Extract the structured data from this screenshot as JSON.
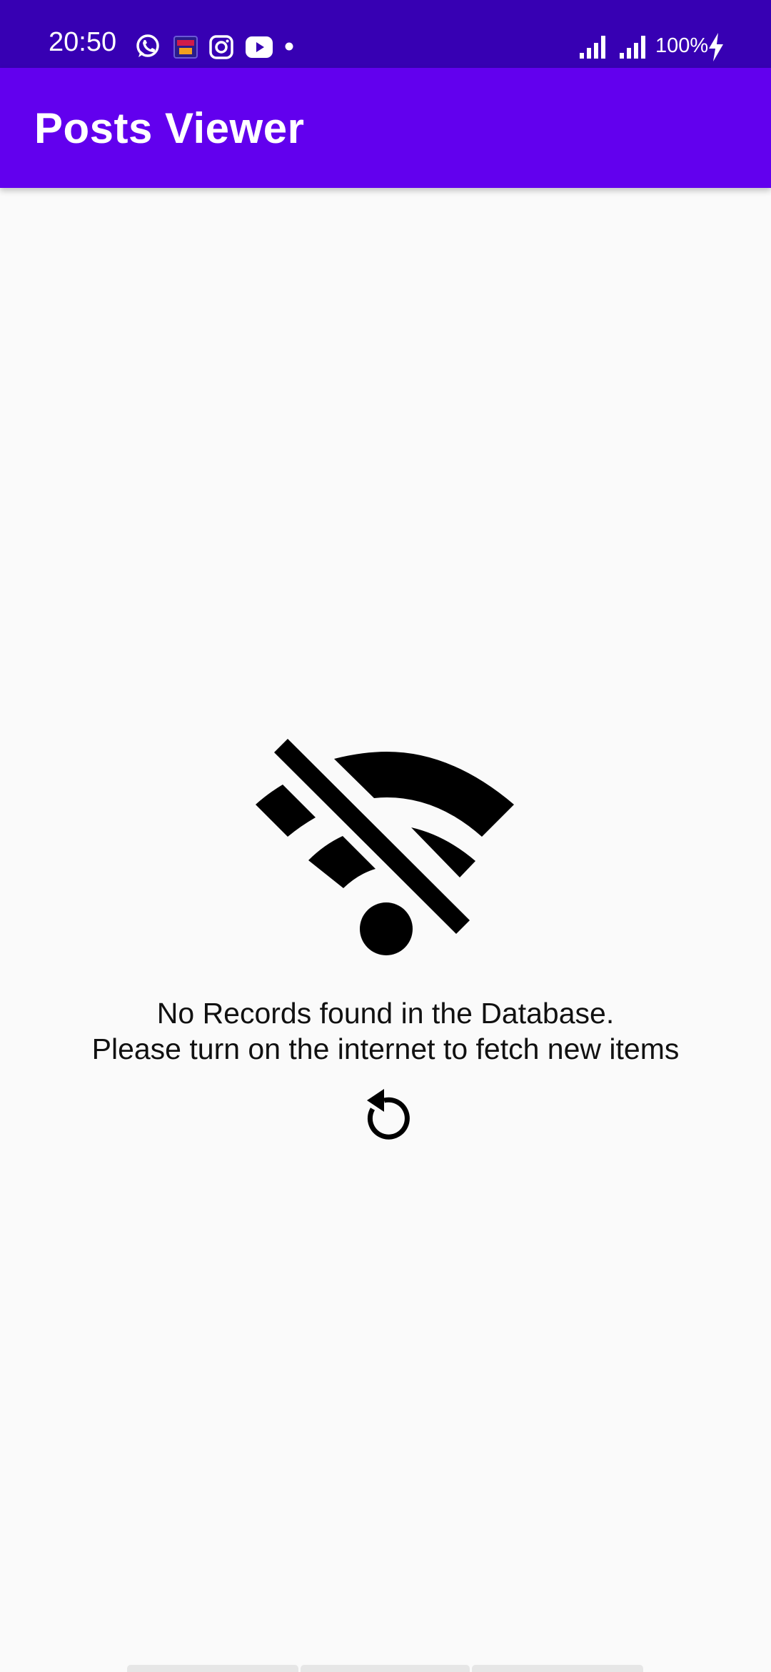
{
  "status_bar": {
    "time": "20:50",
    "battery": "100%",
    "notification_icons": [
      "whatsapp-icon",
      "game-app-icon",
      "instagram-icon",
      "youtube-icon",
      "more-dot-icon"
    ],
    "system_icons": [
      "signal-icon",
      "signal-icon",
      "charging-icon"
    ],
    "background_color": "#3700b3"
  },
  "app_bar": {
    "title": "Posts Viewer",
    "background_color": "#6200ee"
  },
  "empty_state": {
    "icon": "wifi-off-icon",
    "message_line1": "No Records found in the Database.",
    "message_line2": "Please turn on the internet to fetch new items",
    "refresh_icon": "refresh-icon"
  }
}
